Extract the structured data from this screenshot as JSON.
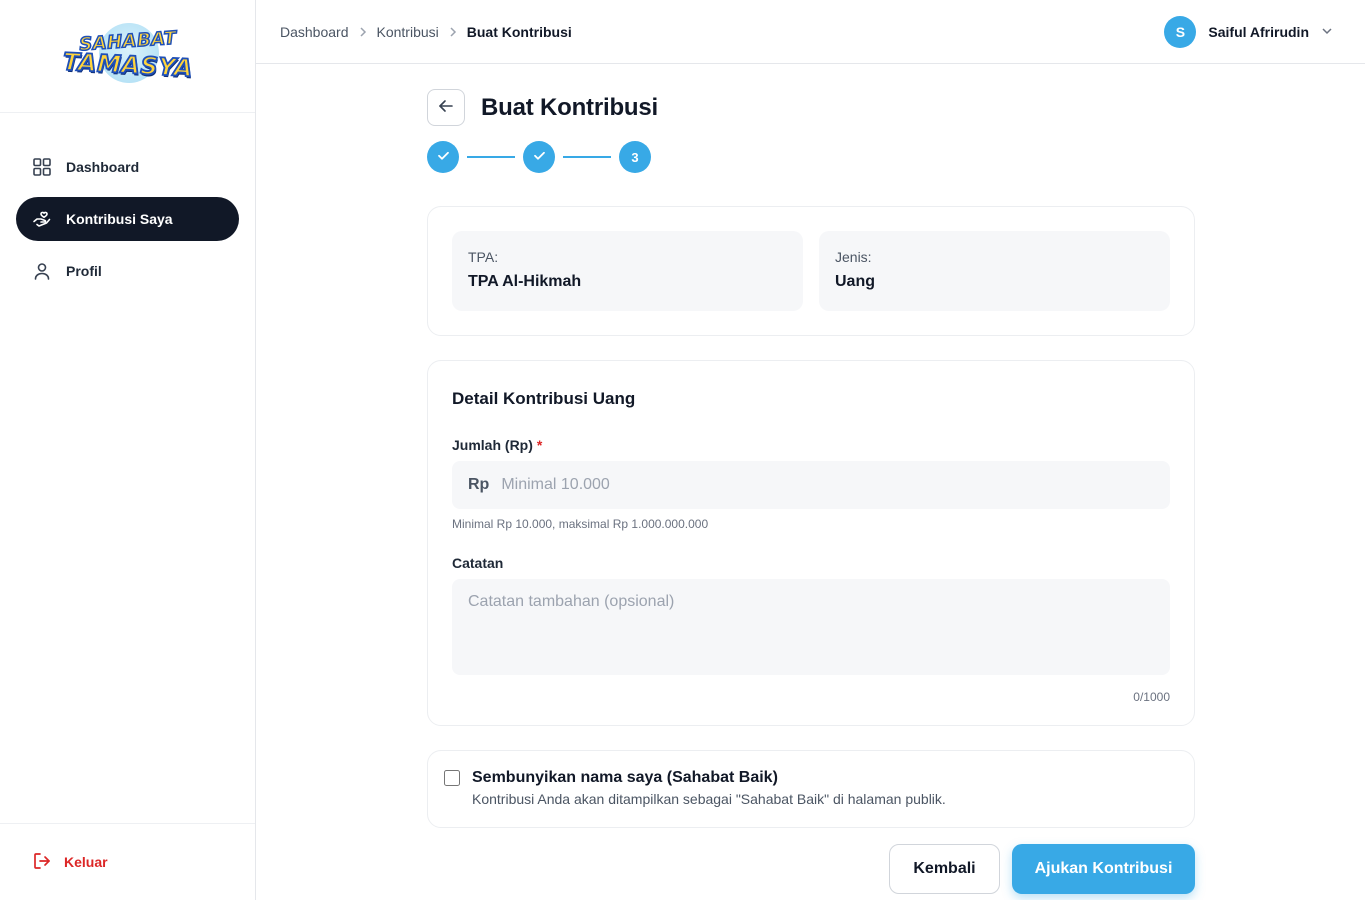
{
  "brand": {
    "logo_line1": "SAHABAT",
    "logo_line2": "TAMASYA"
  },
  "sidebar": {
    "items": [
      {
        "label": "Dashboard",
        "icon": "grid-icon",
        "active": false
      },
      {
        "label": "Kontribusi Saya",
        "icon": "hand-heart-icon",
        "active": true
      },
      {
        "label": "Profil",
        "icon": "user-icon",
        "active": false
      }
    ],
    "logout_label": "Keluar"
  },
  "header": {
    "breadcrumbs": [
      "Dashboard",
      "Kontribusi",
      "Buat Kontribusi"
    ],
    "user": {
      "initial": "S",
      "name": "Saiful Afrirudin"
    }
  },
  "page": {
    "title": "Buat Kontribusi",
    "steps": [
      {
        "state": "done",
        "label": ""
      },
      {
        "state": "done",
        "label": ""
      },
      {
        "state": "current",
        "label": "3"
      }
    ]
  },
  "summary": {
    "tpa_label": "TPA:",
    "tpa_value": "TPA Al-Hikmah",
    "jenis_label": "Jenis:",
    "jenis_value": "Uang"
  },
  "detail": {
    "section_title": "Detail Kontribusi Uang",
    "amount_label": "Jumlah (Rp)",
    "required_mark": "*",
    "amount_prefix": "Rp",
    "amount_placeholder": "Minimal 10.000",
    "amount_value": "",
    "amount_hint": "Minimal Rp 10.000, maksimal Rp 1.000.000.000",
    "note_label": "Catatan",
    "note_placeholder": "Catatan tambahan (opsional)",
    "note_counter": "0/1000"
  },
  "anonymous": {
    "title": "Sembunyikan nama saya (Sahabat Baik)",
    "description": "Kontribusi Anda akan ditampilkan sebagai \"Sahabat Baik\" di halaman publik.",
    "checked": false
  },
  "actions": {
    "back_label": "Kembali",
    "submit_label": "Ajukan Kontribusi"
  },
  "colors": {
    "accent": "#38a9e6",
    "dark": "#111827",
    "danger": "#dc2626"
  }
}
